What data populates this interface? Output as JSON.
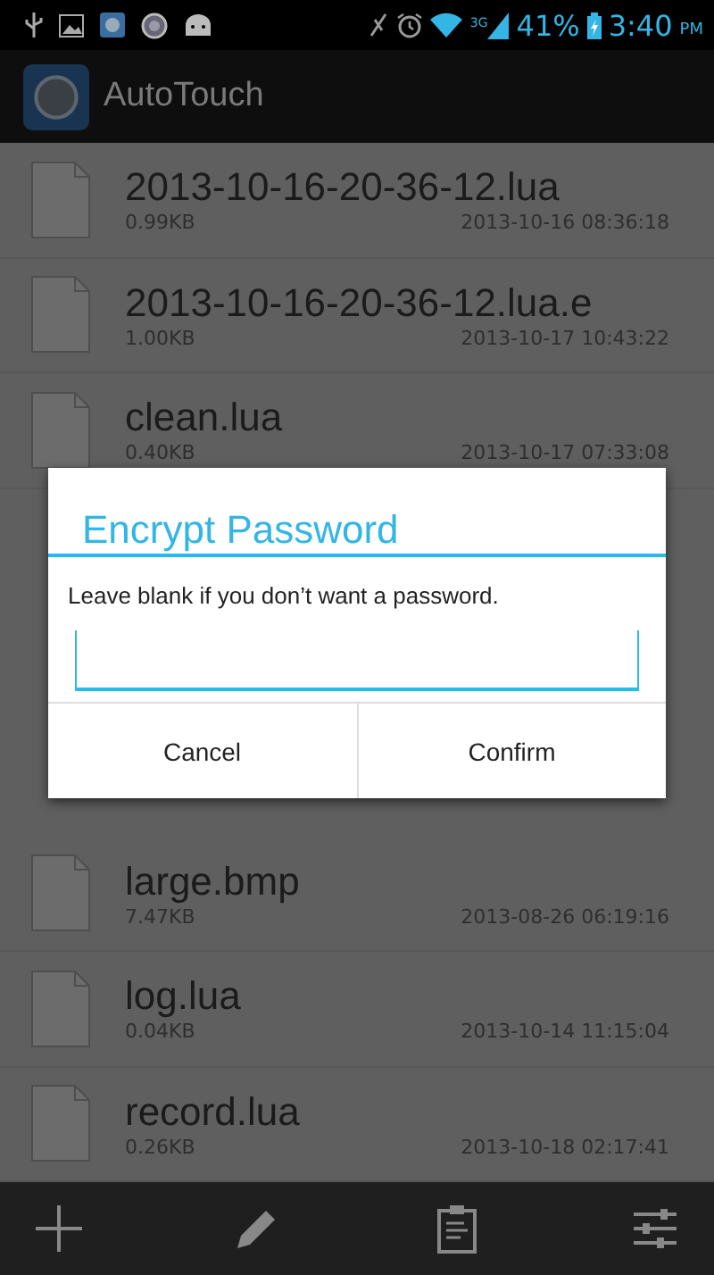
{
  "status_bar": {
    "battery_text": "41%",
    "time": "3:40",
    "ampm": "PM",
    "network": "3G"
  },
  "app_bar": {
    "title": "AutoTouch"
  },
  "files_above": [
    {
      "name": "2013-10-16-20-36-12.lua",
      "size": "0.99KB",
      "date": "2013-10-16 08:36:18"
    },
    {
      "name": "2013-10-16-20-36-12.lua.e",
      "size": "1.00KB",
      "date": "2013-10-17 10:43:22"
    },
    {
      "name": "clean.lua",
      "size": "0.40KB",
      "date": "2013-10-17 07:33:08"
    }
  ],
  "files_below": [
    {
      "name": "large.bmp",
      "size": "7.47KB",
      "date": "2013-08-26 06:19:16"
    },
    {
      "name": "log.lua",
      "size": "0.04KB",
      "date": "2013-10-14 11:15:04"
    },
    {
      "name": "record.lua",
      "size": "0.26KB",
      "date": "2013-10-18 02:17:41"
    }
  ],
  "dialog": {
    "title": "Encrypt Password",
    "message": "Leave blank if you don’t want a password.",
    "buttons": [
      "Cancel",
      "Confirm"
    ]
  }
}
